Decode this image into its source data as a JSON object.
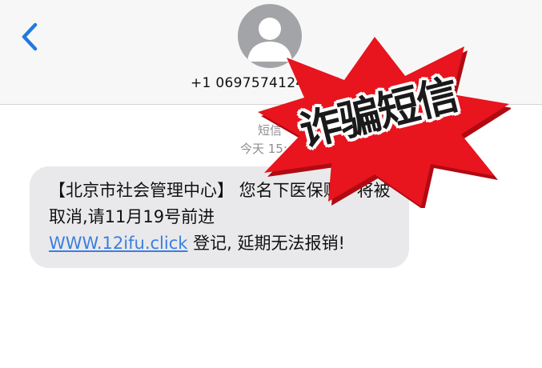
{
  "header": {
    "contact_number": "+1 06975741241025"
  },
  "message_meta": {
    "service": "短信",
    "timestamp": "今天 15:"
  },
  "message": {
    "part1": "【北京市社会管理中心】 您名下医保账户将被取消,请11月19号前进",
    "link_text": "WWW.12ifu.click",
    "part2": " 登记, 延期无法报销!"
  },
  "stamp": {
    "text": "诈骗短信",
    "colors": {
      "burst": "#e8141e",
      "burst_shadow": "#b00a12",
      "text": "#1a1a1a"
    }
  },
  "icons": {
    "back": "chevron-left-icon",
    "avatar": "person-silhouette-icon"
  },
  "colors": {
    "header_bg": "#f7f7f7",
    "bubble_bg": "#e9e9eb",
    "link": "#3b7ee0",
    "accent": "#1f7ae0",
    "avatar_bg": "#a3a4a8"
  }
}
